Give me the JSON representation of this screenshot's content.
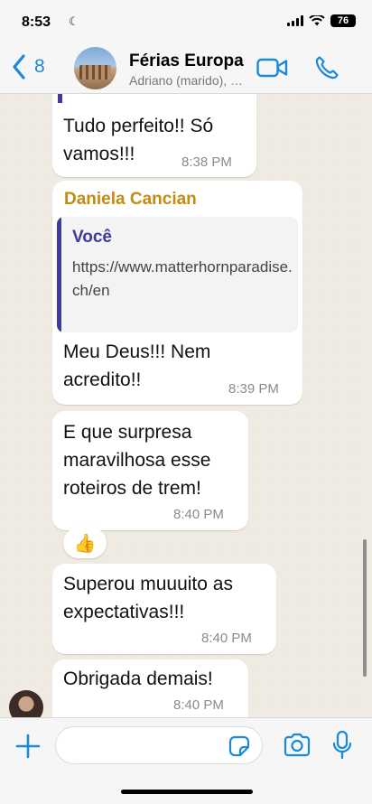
{
  "status_bar": {
    "time": "8:53",
    "battery": "76"
  },
  "header": {
    "back_count": "8",
    "chat_title": "Férias Europa",
    "subtitle": "Adriano (marido), Daniela Cancian, Você"
  },
  "messages": [
    {
      "text": "Tudo perfeito!! Só vamos!!!",
      "time": "8:38 PM"
    },
    {
      "sender": "Daniela Cancian",
      "quote": {
        "author": "Você",
        "text": "https://www.matterhornparadise.ch/en"
      },
      "text": "Meu Deus!!! Nem acredito!!",
      "time": "8:39 PM"
    },
    {
      "text": "E que surpresa maravilhosa esse roteiros de trem!",
      "time": "8:40 PM",
      "reaction": "👍"
    },
    {
      "text": "Superou muuuito as expectativas!!!",
      "time": "8:40 PM"
    },
    {
      "text": "Obrigada demais!",
      "time": "8:40 PM"
    }
  ],
  "colors": {
    "accent_blue": "#1a8ad8",
    "sender_color": "#c58b10",
    "quote_author_color": "#3e3a9e",
    "chat_background": "#efeae2"
  },
  "icons": [
    "back-chevron-icon",
    "video-call-icon",
    "phone-icon",
    "plus-icon",
    "sticker-icon",
    "camera-icon",
    "microphone-icon"
  ]
}
